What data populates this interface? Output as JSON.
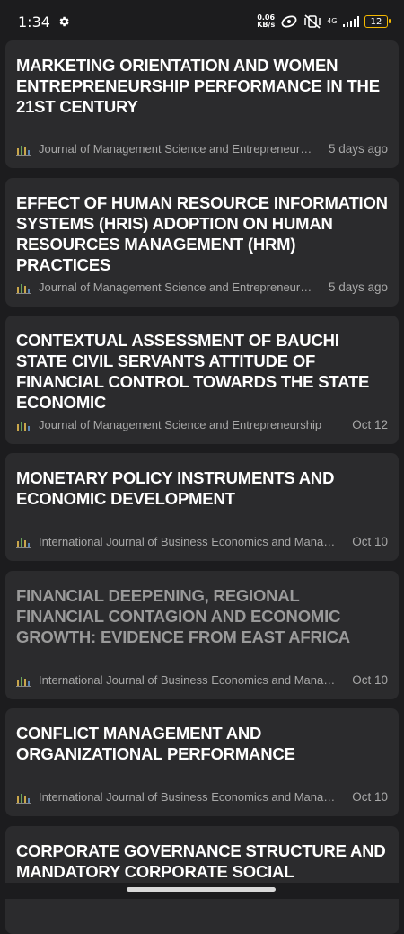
{
  "status_bar": {
    "time": "1:34",
    "net_speed_value": "0.06",
    "net_speed_unit": "KB/s",
    "network": "4G",
    "battery": "12"
  },
  "articles": [
    {
      "title": "MARKETING ORIENTATION AND WOMEN ENTREPRENEURSHIP PERFORMANCE IN THE 21ST CENTURY",
      "journal": "Journal of Management Science and Entrepreneurship",
      "date": "5 days ago",
      "read": false
    },
    {
      "title": "EFFECT OF HUMAN RESOURCE INFORMATION SYSTEMS (HRIS) ADOPTION ON HUMAN RESOURCES MANAGEMENT (HRM) PRACTICES",
      "journal": "Journal of Management Science and Entrepreneurship",
      "date": "5 days ago",
      "read": false
    },
    {
      "title": "CONTEXTUAL ASSESSMENT OF BAUCHI STATE CIVIL SERVANTS ATTITUDE OF FINANCIAL CONTROL TOWARDS THE STATE ECONOMIC",
      "journal": "Journal of Management Science and Entrepreneurship",
      "date": "Oct 12",
      "read": false
    },
    {
      "title": "MONETARY POLICY INSTRUMENTS AND ECONOMIC DEVELOPMENT",
      "journal": "International Journal of Business Economics and Manage…",
      "date": "Oct 10",
      "read": false
    },
    {
      "title": "FINANCIAL DEEPENING, REGIONAL FINANCIAL CONTAGION AND ECONOMIC GROWTH: EVIDENCE FROM EAST AFRICA",
      "journal": "International Journal of Business Economics and Manage…",
      "date": "Oct 10",
      "read": true
    },
    {
      "title": "CONFLICT MANAGEMENT AND ORGANIZATIONAL PERFORMANCE",
      "journal": "International Journal of Business Economics and Manage…",
      "date": "Oct 10",
      "read": false
    },
    {
      "title": "CORPORATE GOVERNANCE STRUCTURE AND MANDATORY CORPORATE SOCIAL",
      "journal": "",
      "date": "",
      "read": false
    }
  ]
}
